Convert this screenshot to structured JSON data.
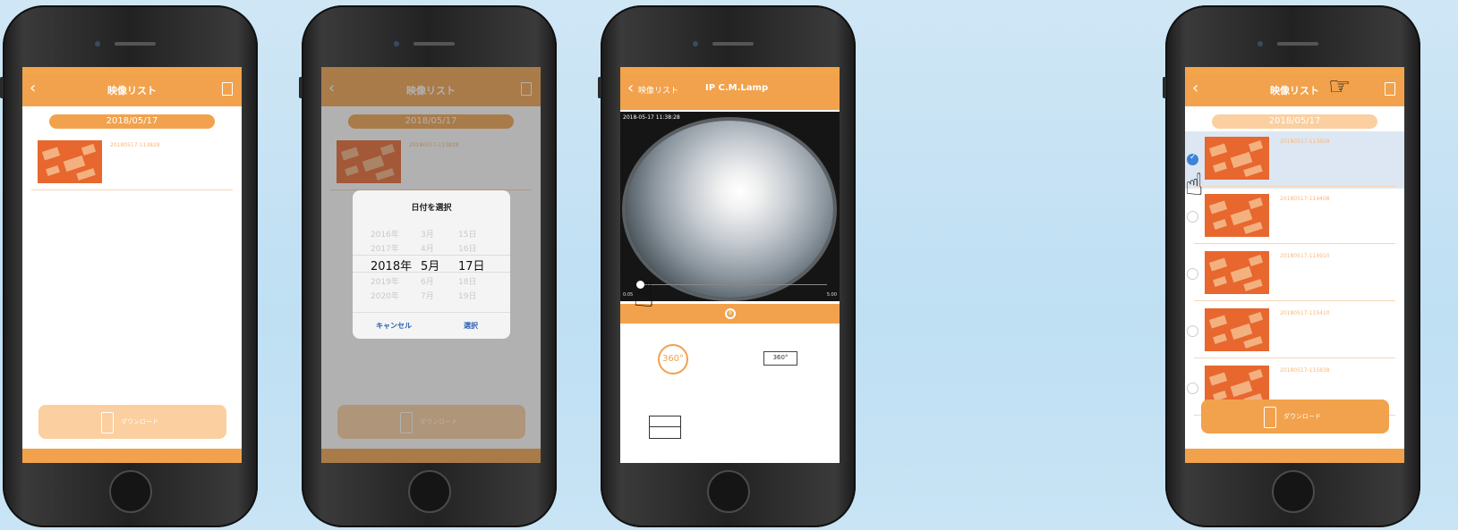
{
  "phone1": {
    "nav_title": "映像リスト",
    "date": "2018/05/17",
    "items": [
      {
        "filename": "20180517-113828"
      }
    ],
    "download_label": "ダウンロード"
  },
  "phone2": {
    "nav_title": "映像リスト",
    "date": "2018/05/17",
    "items": [
      {
        "filename": "20180517-113828"
      }
    ],
    "download_label": "ダウンロード",
    "picker": {
      "title": "日付を選択",
      "rows": [
        {
          "year": "2016年",
          "month": "3月",
          "day": "15日",
          "selected": false
        },
        {
          "year": "2017年",
          "month": "4月",
          "day": "16日",
          "selected": false
        },
        {
          "year": "2018年",
          "month": "5月",
          "day": "17日",
          "selected": true
        },
        {
          "year": "2019年",
          "month": "6月",
          "day": "18日",
          "selected": false
        },
        {
          "year": "2020年",
          "month": "7月",
          "day": "19日",
          "selected": false
        }
      ],
      "cancel_label": "キャンセル",
      "ok_label": "選択"
    }
  },
  "phone3": {
    "back_label": "映像リスト",
    "nav_title": "IP C.M.Lamp",
    "video_timestamp": "2018-05-17 11:38:28",
    "time_start": "0:05",
    "time_end": "5:00",
    "mode_360_label": "360°",
    "mode_panorama_label": "360°"
  },
  "phone4": {
    "nav_title": "映像リスト",
    "date": "2018/05/17",
    "items": [
      {
        "filename": "20180517-113828",
        "checked": true
      },
      {
        "filename": "20180517-114408",
        "checked": false
      },
      {
        "filename": "20180517-114910",
        "checked": false
      },
      {
        "filename": "20180517-115410",
        "checked": false
      },
      {
        "filename": "20180517-115838",
        "checked": false
      }
    ],
    "download_label": "ダウンロード"
  },
  "colors": {
    "accent": "#f2a24c",
    "background": "#c7e3f5",
    "check": "#3f82d6"
  }
}
